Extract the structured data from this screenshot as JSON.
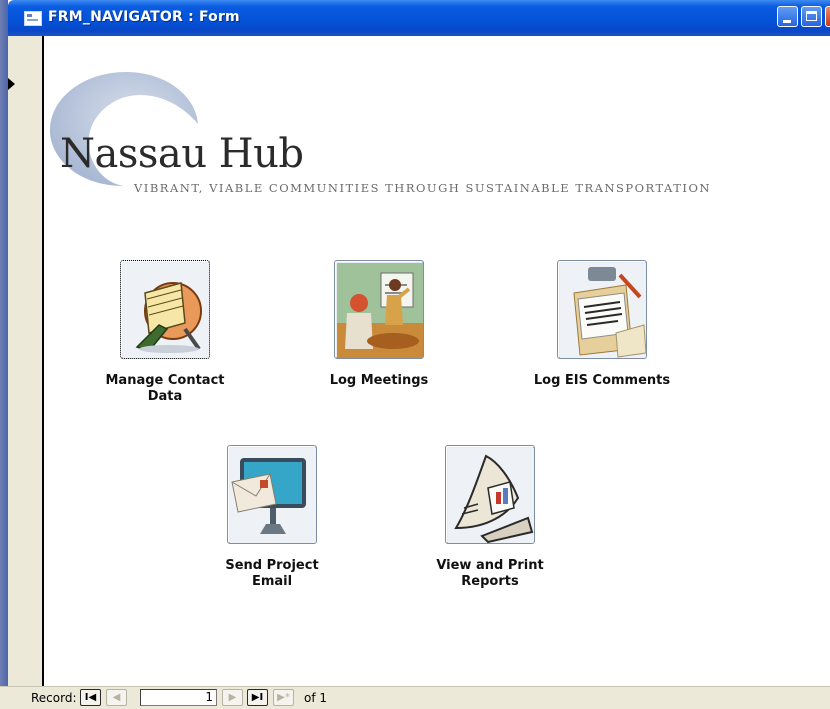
{
  "window": {
    "title": "FRM_NAVIGATOR : Form"
  },
  "logo": {
    "name": "Nassau Hub",
    "tagline": "VIBRANT, VIABLE COMMUNITIES THROUGH SUSTAINABLE TRANSPORTATION"
  },
  "buttons": [
    {
      "label_line1": "Manage Contact",
      "label_line2": "Data",
      "icon": "rolodex-icon",
      "selected": true
    },
    {
      "label_line1": "Log Meetings",
      "label_line2": "",
      "icon": "presentation-meeting-icon",
      "selected": false
    },
    {
      "label_line1": "Log EIS Comments",
      "label_line2": "",
      "icon": "clipboard-comments-icon",
      "selected": false
    },
    {
      "label_line1": "Send Project",
      "label_line2": "Email",
      "icon": "monitor-email-icon",
      "selected": false
    },
    {
      "label_line1": "View and Print",
      "label_line2": "Reports",
      "icon": "open-report-icon",
      "selected": false
    }
  ],
  "record_navigator": {
    "label": "Record:",
    "current": "1",
    "of_text": "of 1",
    "first_glyph": "I◀",
    "prev_glyph": "◀",
    "next_glyph": "▶",
    "last_glyph": "▶I",
    "new_glyph": "▶*"
  },
  "colors": {
    "titlebar": "#0453d8",
    "chrome": "#ece9d8",
    "logo_arc": "#b9c6dc"
  }
}
